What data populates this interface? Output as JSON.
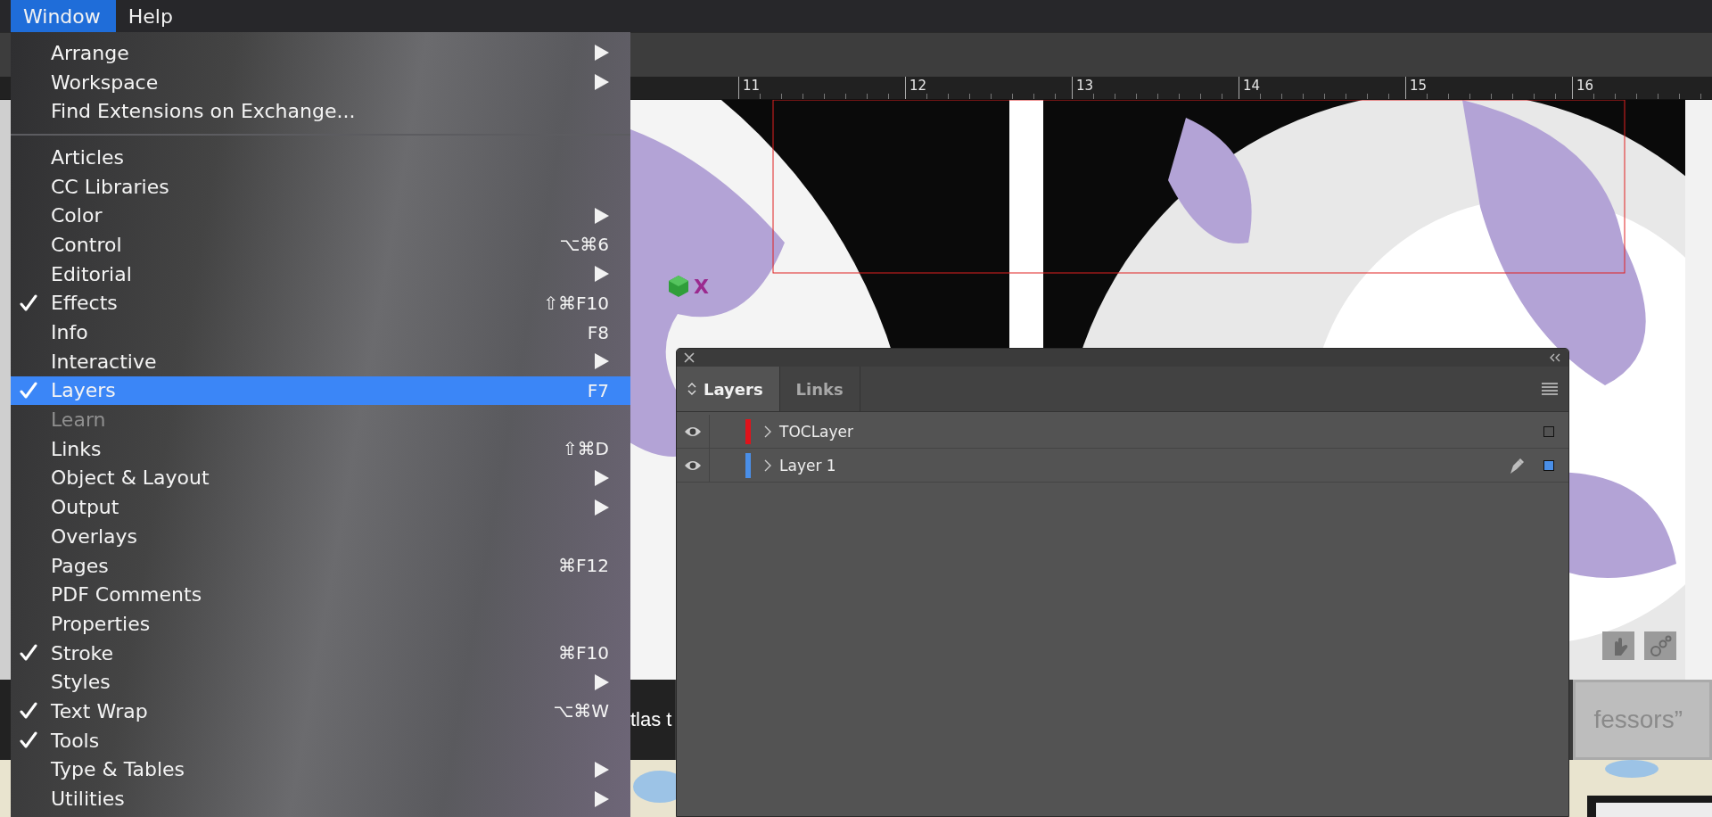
{
  "menu_bar": [
    {
      "label": "Window",
      "selected": true
    },
    {
      "label": "Help",
      "selected": false
    }
  ],
  "ruler": {
    "labels": [
      "11",
      "12",
      "13",
      "14",
      "15",
      "16"
    ]
  },
  "document": {
    "marker": "X",
    "captions": [
      {
        "text": "tlas t",
        "kind": "dark"
      },
      {
        "text": "fessors”",
        "kind": "light"
      }
    ]
  },
  "window_menu": {
    "groups": [
      [
        {
          "label": "Arrange",
          "checked": false,
          "submenu": true,
          "disabled": false,
          "selected": false
        },
        {
          "label": "Workspace",
          "checked": false,
          "submenu": true,
          "disabled": false,
          "selected": false
        },
        {
          "label": "Find Extensions on Exchange...",
          "checked": false,
          "submenu": false,
          "disabled": false,
          "selected": false
        }
      ],
      [
        {
          "label": "Articles",
          "checked": false,
          "submenu": false,
          "disabled": false,
          "selected": false
        },
        {
          "label": "CC Libraries",
          "checked": false,
          "submenu": false,
          "disabled": false,
          "selected": false
        },
        {
          "label": "Color",
          "checked": false,
          "submenu": true,
          "disabled": false,
          "selected": false
        },
        {
          "label": "Control",
          "checked": false,
          "submenu": false,
          "disabled": false,
          "selected": false,
          "shortcut": "⌥⌘6"
        },
        {
          "label": "Editorial",
          "checked": false,
          "submenu": true,
          "disabled": false,
          "selected": false
        },
        {
          "label": "Effects",
          "checked": true,
          "submenu": false,
          "disabled": false,
          "selected": false,
          "shortcut": "⇧⌘F10"
        },
        {
          "label": "Info",
          "checked": false,
          "submenu": false,
          "disabled": false,
          "selected": false,
          "shortcut": "F8"
        },
        {
          "label": "Interactive",
          "checked": false,
          "submenu": true,
          "disabled": false,
          "selected": false
        },
        {
          "label": "Layers",
          "checked": true,
          "submenu": false,
          "disabled": false,
          "selected": true,
          "shortcut": "F7"
        },
        {
          "label": "Learn",
          "checked": false,
          "submenu": false,
          "disabled": true,
          "selected": false
        },
        {
          "label": "Links",
          "checked": false,
          "submenu": false,
          "disabled": false,
          "selected": false,
          "shortcut": "⇧⌘D"
        },
        {
          "label": "Object & Layout",
          "checked": false,
          "submenu": true,
          "disabled": false,
          "selected": false
        },
        {
          "label": "Output",
          "checked": false,
          "submenu": true,
          "disabled": false,
          "selected": false
        },
        {
          "label": "Overlays",
          "checked": false,
          "submenu": false,
          "disabled": false,
          "selected": false
        },
        {
          "label": "Pages",
          "checked": false,
          "submenu": false,
          "disabled": false,
          "selected": false,
          "shortcut": "⌘F12"
        },
        {
          "label": "PDF Comments",
          "checked": false,
          "submenu": false,
          "disabled": false,
          "selected": false
        },
        {
          "label": "Properties",
          "checked": false,
          "submenu": false,
          "disabled": false,
          "selected": false
        },
        {
          "label": "Stroke",
          "checked": true,
          "submenu": false,
          "disabled": false,
          "selected": false,
          "shortcut": "⌘F10"
        },
        {
          "label": "Styles",
          "checked": false,
          "submenu": true,
          "disabled": false,
          "selected": false
        },
        {
          "label": "Text Wrap",
          "checked": true,
          "submenu": false,
          "disabled": false,
          "selected": false,
          "shortcut": "⌥⌘W"
        },
        {
          "label": "Tools",
          "checked": true,
          "submenu": false,
          "disabled": false,
          "selected": false
        },
        {
          "label": "Type & Tables",
          "checked": false,
          "submenu": true,
          "disabled": false,
          "selected": false
        },
        {
          "label": "Utilities",
          "checked": false,
          "submenu": true,
          "disabled": false,
          "selected": false
        }
      ]
    ]
  },
  "layers_panel": {
    "tabs": [
      {
        "label": "Layers",
        "selected": true
      },
      {
        "label": "Links",
        "selected": false
      }
    ],
    "layers": [
      {
        "name": "TOCLayer",
        "visible": true,
        "color": "#e0131b",
        "current": false,
        "selected": false
      },
      {
        "name": "Layer 1",
        "visible": true,
        "color": "#4a8fe8",
        "current": true,
        "selected": true
      }
    ]
  }
}
